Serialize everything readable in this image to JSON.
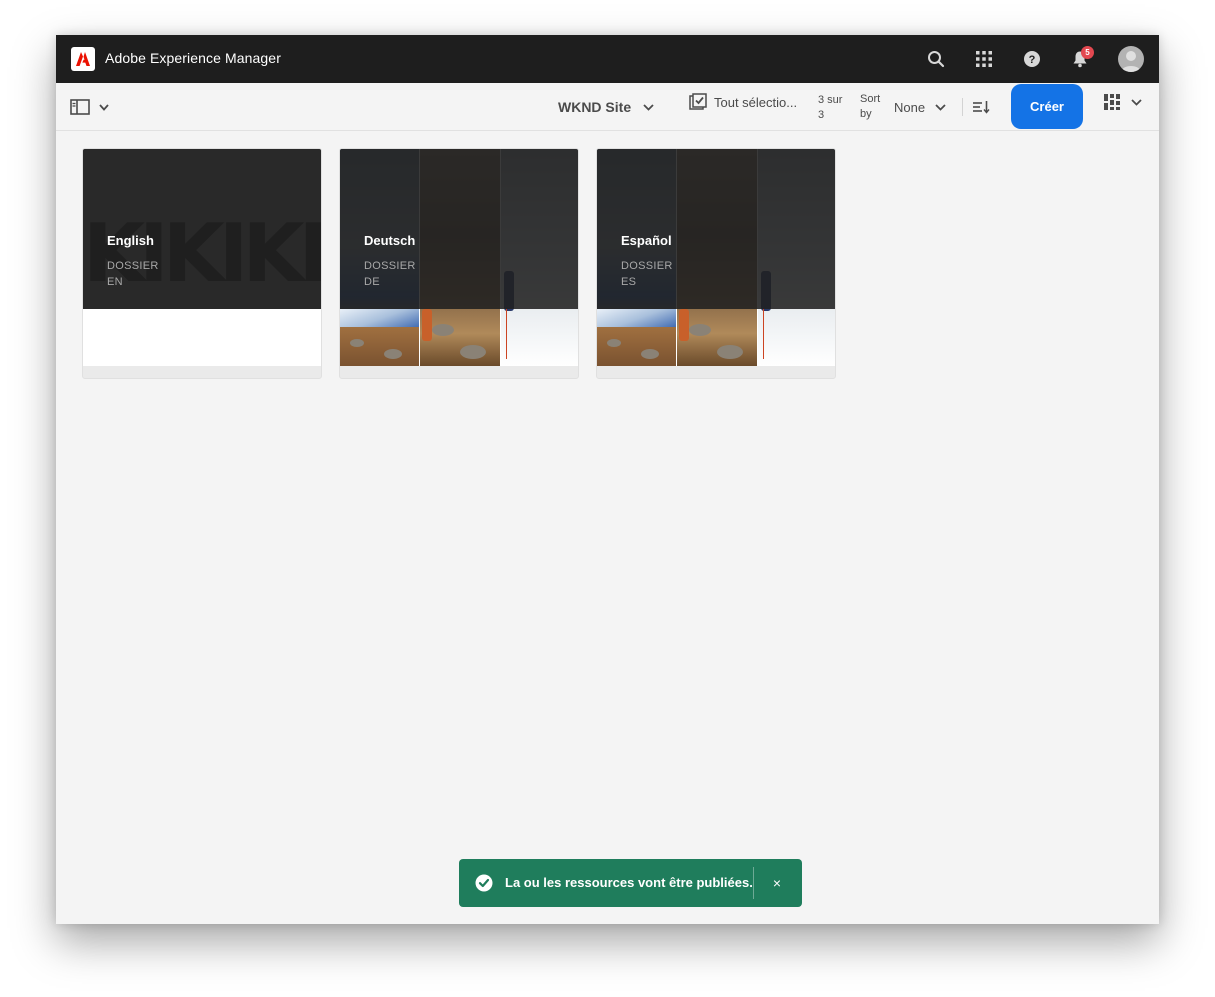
{
  "app": {
    "title": "Adobe Experience Manager"
  },
  "shell": {
    "icons": [
      "search-icon",
      "apps-grid-icon",
      "help-icon",
      "bell-icon",
      "avatar"
    ],
    "notification_count": "5"
  },
  "toolbar": {
    "site_title": "WKND Site",
    "select_all_label": "Tout sélectio...",
    "count_line1": "3 sur",
    "count_line2": "3",
    "sort_label_line1": "Sort",
    "sort_label_line2": "by",
    "sort_value": "None",
    "create_label": "Créer"
  },
  "cards": [
    {
      "title": "English",
      "type": "DOSSIER",
      "code": "EN",
      "thumbnail": "wknd-logo"
    },
    {
      "title": "Deutsch",
      "type": "DOSSIER",
      "code": "DE",
      "thumbnail": "hiking-collage"
    },
    {
      "title": "Español",
      "type": "DOSSIER",
      "code": "ES",
      "thumbnail": "hiking-collage"
    }
  ],
  "toast": {
    "message": "La ou les ressources vont être publiées.",
    "close": "×"
  },
  "colors": {
    "shell": "#1e1e1e",
    "accent": "#1473e6",
    "toast": "#1f7d5c",
    "badge": "#e34850",
    "background": "#f4f4f4"
  }
}
